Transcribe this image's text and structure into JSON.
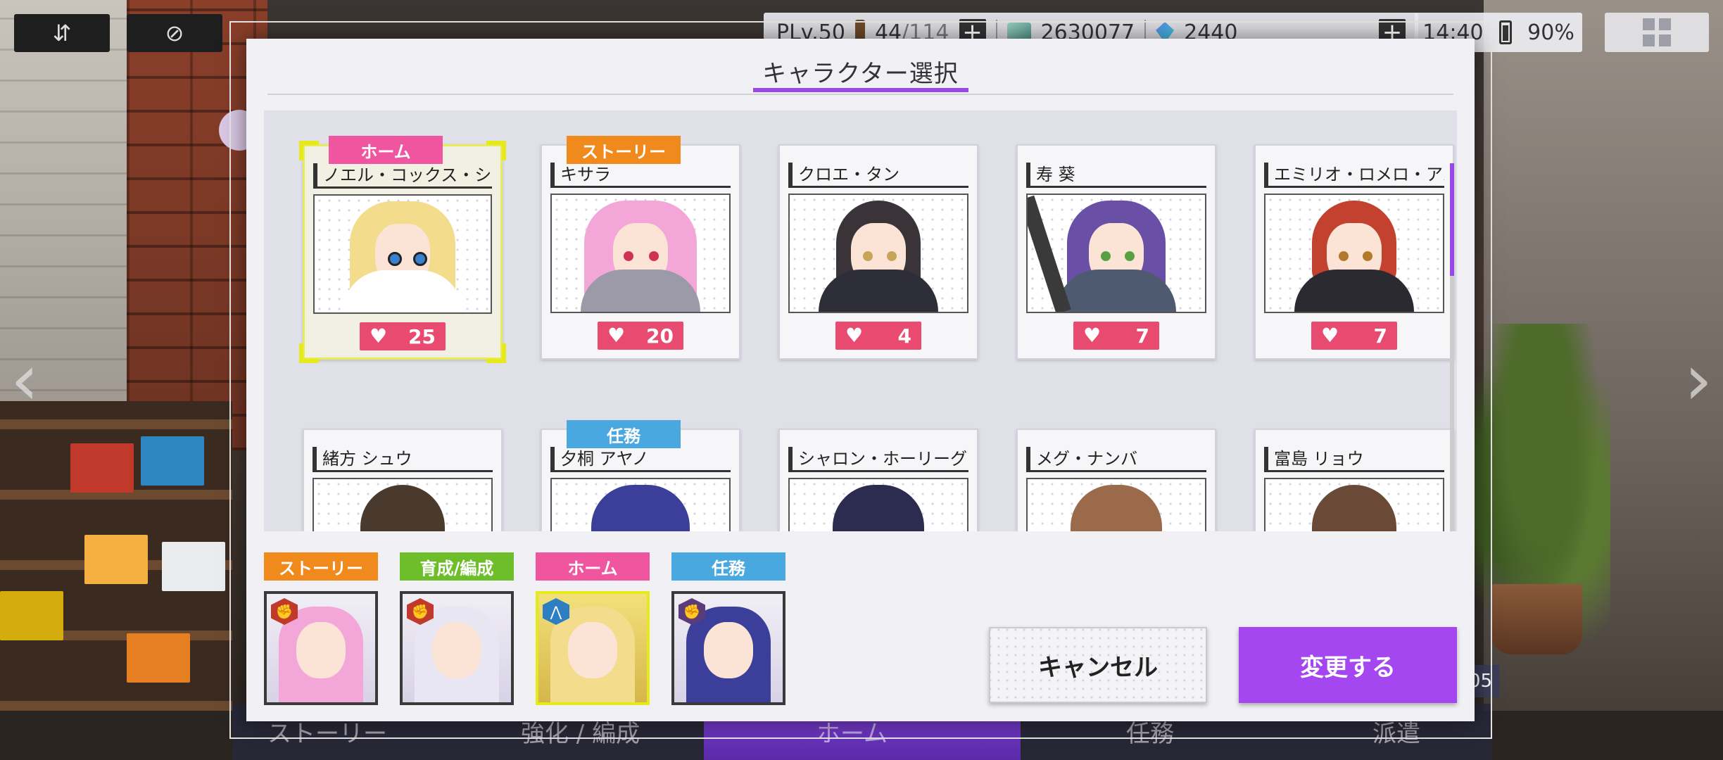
{
  "hud": {
    "player_level": "PLv.50",
    "stamina_current": "44",
    "stamina_max": "/114",
    "credits": "2630077",
    "gems": "2440",
    "time": "14:40",
    "battery": "90%"
  },
  "background": {
    "nav_story": "ストーリー",
    "nav_training": "強化 / 編成",
    "nav_home": "ホーム",
    "nav_mission": "任務",
    "nav_dispatch": "派遣",
    "time_badge": ":05"
  },
  "modal": {
    "title": "キャラクター選択",
    "cancel_label": "キャンセル",
    "confirm_label": "変更する"
  },
  "characters": [
    {
      "name": "ノエル・コックス・シャン",
      "affection": "25",
      "tag": "ホーム",
      "tag_color": "#f0559f",
      "selected": true
    },
    {
      "name": "キサラ",
      "affection": "20",
      "tag": "ストーリー",
      "tag_color": "#f08a1c",
      "selected": false
    },
    {
      "name": "クロエ・タン",
      "affection": "4",
      "tag": "",
      "selected": false
    },
    {
      "name": "寿 葵",
      "affection": "7",
      "tag": "",
      "selected": false
    },
    {
      "name": "エミリオ・ロメロ・アルバ",
      "affection": "7",
      "tag": "",
      "selected": false
    },
    {
      "name": "緒方 シュウ",
      "tag": ""
    },
    {
      "name": "夕桐 アヤノ",
      "tag": "任務",
      "tag_color": "#4aa8e0"
    },
    {
      "name": "シャロン・ホーリーグレイ",
      "tag": ""
    },
    {
      "name": "メグ・ナンバ",
      "tag": ""
    },
    {
      "name": "富島 リョウ",
      "tag": ""
    }
  ],
  "slots": [
    {
      "label": "ストーリー",
      "color": "#f08a1c"
    },
    {
      "label": "育成/編成",
      "color": "#6ebe2c"
    },
    {
      "label": "ホーム",
      "color": "#f0559f"
    },
    {
      "label": "任務",
      "color": "#4aa8e0"
    }
  ],
  "colors": {
    "accent": "#a547f0",
    "heart_badge": "#e94a6f",
    "selection": "#e6e91a"
  }
}
